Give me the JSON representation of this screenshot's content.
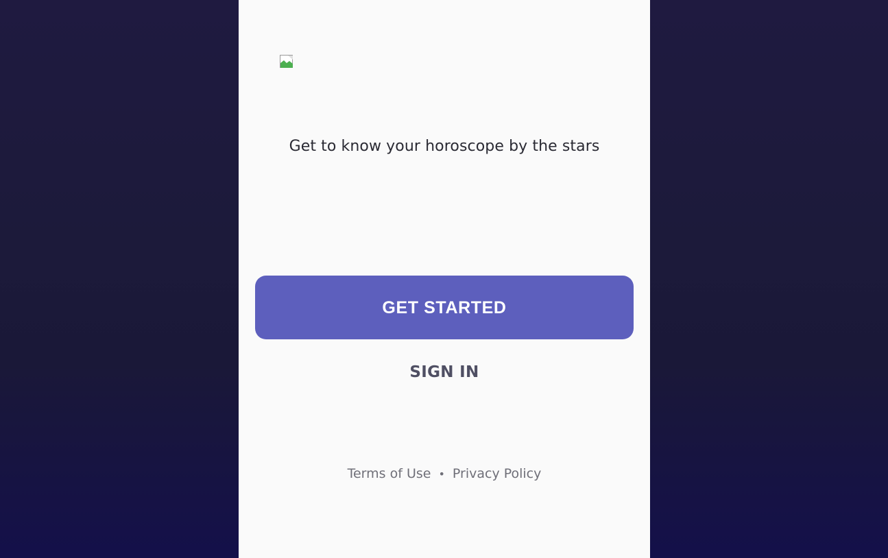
{
  "onboarding": {
    "logo_icon": "broken-image-icon",
    "tagline": "Get to know your horoscope by the stars",
    "get_started_label": "GET STARTED",
    "sign_in_label": "SIGN IN"
  },
  "footer": {
    "terms_label": "Terms of Use",
    "separator": "•",
    "privacy_label": "Privacy Policy"
  },
  "colors": {
    "primary_button": "#5d5fbd",
    "panel_background": "#fafafa",
    "page_background": "#1c1a3a"
  }
}
